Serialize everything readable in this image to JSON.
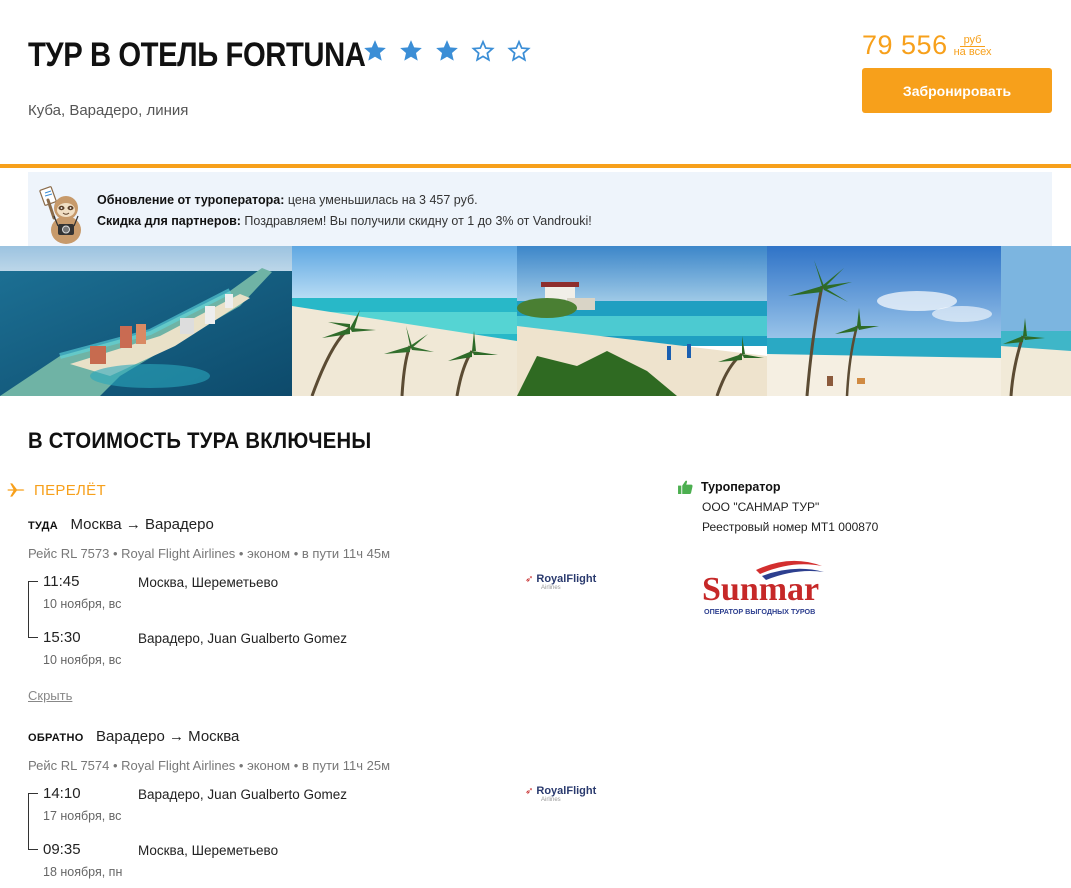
{
  "header": {
    "title": "ТУР В ОТЕЛЬ FORTUNA",
    "rating": 3,
    "rating_max": 5,
    "location": "Куба, Варадеро, линия",
    "price": "79 556",
    "price_currency": "руб",
    "price_for": "на всех",
    "book_label": "Забронировать"
  },
  "notice": {
    "update_label": "Обновление от туроператора:",
    "update_text": " цена уменьшилась на 3 457 руб.",
    "discount_label": "Скидка для партнеров:",
    "discount_text": " Поздравляем! Вы получили скидну от 1 до 3% от Vandrouki!"
  },
  "section_title": "В СТОИМОСТЬ ТУРА ВКЛЮЧЕНЫ",
  "flight": {
    "label": "ПЕРЕЛЁТ",
    "hide_label": "Скрыть",
    "legs": [
      {
        "direction": "ТУДА",
        "route": "Москва → Варадеро",
        "meta": "Рейс RL 7573 • Royal Flight Airlines • эконом • в пути 11ч 45м",
        "airline": "RoyalFlight",
        "airline_sub": "Airlines",
        "dep_time": "11:45",
        "dep_date": "10 ноября, вс",
        "dep_place": "Москва, Шереметьево",
        "arr_time": "15:30",
        "arr_date": "10 ноября, вс",
        "arr_place": "Варадеро, Juan Gualberto Gomez"
      },
      {
        "direction": "ОБРАТНО",
        "route": "Варадеро → Москва",
        "meta": "Рейс RL 7574 • Royal Flight Airlines • эконом • в пути 11ч 25м",
        "airline": "RoyalFlight",
        "airline_sub": "Airlines",
        "dep_time": "14:10",
        "dep_date": "17 ноября, вс",
        "dep_place": "Варадеро, Juan Gualberto Gomez",
        "arr_time": "09:35",
        "arr_date": "18 ноября, пн",
        "arr_place": "Москва, Шереметьево"
      }
    ]
  },
  "operator": {
    "heading": "Туроператор",
    "company": "ООО \"САНМАР ТУР\"",
    "registry": "Реестровый номер МТ1 000870",
    "logo_text": "Sunmar",
    "logo_tagline": "ОПЕРАТОР ВЫГОДНЫХ ТУРОВ"
  },
  "colors": {
    "accent": "#f7a01b",
    "star": "#3b8ed6",
    "notice_bg": "#eef4fb"
  }
}
